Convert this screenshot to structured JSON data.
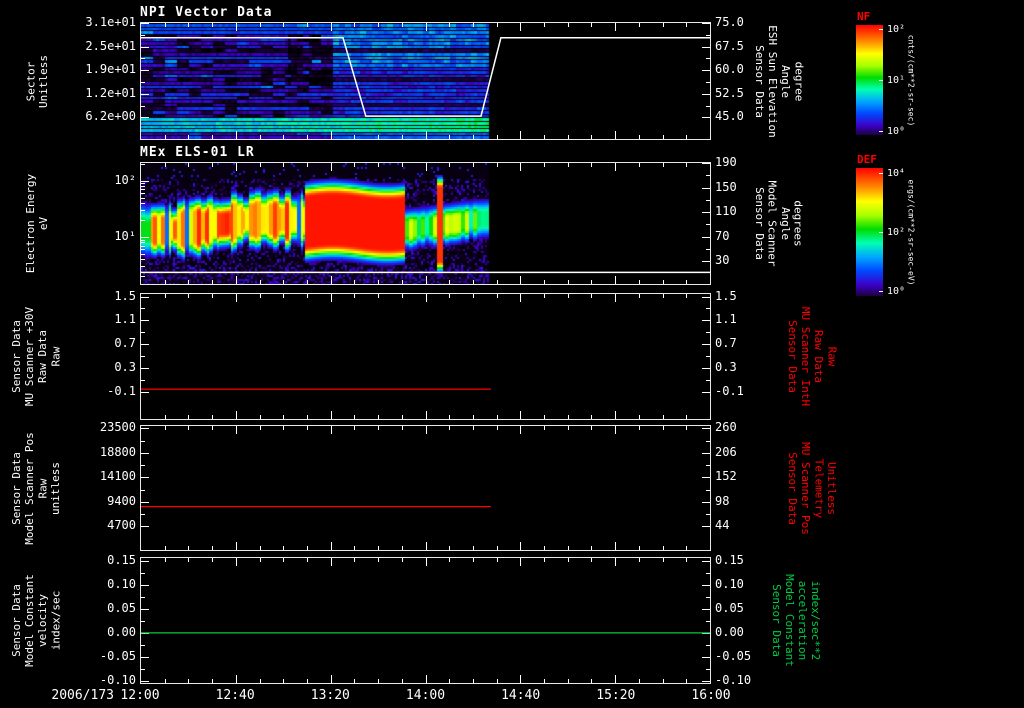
{
  "window": {
    "background": "#000000",
    "text_color": "#ffffff",
    "accent_red": "#ff0000",
    "accent_green": "#00cc44"
  },
  "time_axis": {
    "date_label": "2006/173",
    "tick_labels": [
      "12:00",
      "12:40",
      "13:20",
      "14:00",
      "14:40",
      "15:20",
      "16:00"
    ],
    "start": "12:00",
    "end": "16:00",
    "hours_span": 4
  },
  "colormap": {
    "stops": [
      0,
      0.08,
      0.16,
      0.26,
      0.36,
      0.46,
      0.56,
      0.66,
      0.76,
      0.86,
      1
    ],
    "colors": [
      "#000000",
      "#1c0040",
      "#3c00c8",
      "#0048ff",
      "#00a6ff",
      "#00ffb4",
      "#00dc00",
      "#a8ff00",
      "#ffff00",
      "#ff8c00",
      "#ff0000"
    ]
  },
  "colorbars": [
    {
      "title": "NF",
      "title_color": "#ff0000",
      "tick_labels": [
        "10²",
        "10¹",
        "10⁰"
      ],
      "tick_fracs": [
        0.04,
        0.5,
        0.96
      ],
      "unit": "cnts/(cm**2-sr-sec)"
    },
    {
      "title": "DEF",
      "title_color": "#ff0000",
      "tick_labels": [
        "10⁴",
        "10²",
        "10⁰"
      ],
      "tick_fracs": [
        0.04,
        0.5,
        0.96
      ],
      "unit": "ergs/(cm**2-sr-sec-eV)"
    }
  ],
  "chart_data": [
    {
      "type": "heatmap",
      "title": "NPI Vector Data",
      "left_label_lines": [
        "Sector",
        "Unitless"
      ],
      "left_label_color": "#ffffff",
      "left_ticks": [
        "3.1e+01",
        "2.5e+01",
        "1.9e+01",
        "1.2e+01",
        "6.2e+00"
      ],
      "left_tick_fracs": [
        0.0,
        0.203,
        0.406,
        0.61,
        0.813
      ],
      "right_ticks": [
        "75.0",
        "67.5",
        "60.0",
        "52.5",
        "45.0"
      ],
      "right_tick_fracs": [
        0.0,
        0.203,
        0.406,
        0.61,
        0.813
      ],
      "right_label_lines": [
        "Sensor Data",
        "ESH Sun Elevation",
        "Angle",
        "degree"
      ],
      "right_label_color": "#ffffff",
      "heatmap": {
        "style": "npi",
        "data_end_frac": 0.61,
        "rows": 32,
        "value_range_counts": [
          1,
          100
        ],
        "description": "Dark blue/purple sector stripes 12:00-13:20 with scattered black dropouts; brighter blue-cyan field 13:20-14:25; bright cyan-green band near the lowest sectors brightening with time; no data after ~14:25"
      },
      "overlay_line": {
        "name": "ESH sun elevation angle",
        "color": "#ffffff",
        "scale": {
          "v0": 75.0,
          "f0": 0.0,
          "v1": 45.0,
          "f1": 0.813
        },
        "points": [
          {
            "t": 0.0,
            "v": 70.3
          },
          {
            "t": 1.42,
            "v": 70.3
          },
          {
            "t": 1.58,
            "v": 45.4
          },
          {
            "t": 2.39,
            "v": 45.4
          },
          {
            "t": 2.53,
            "v": 70.3
          },
          {
            "t": 4.0,
            "v": 70.3
          }
        ]
      }
    },
    {
      "type": "heatmap",
      "title": "MEx ELS-01 LR",
      "left_label_lines": [
        "Electron Energy",
        "eV"
      ],
      "left_label_color": "#ffffff",
      "left_ticks": [
        "10²",
        "10¹"
      ],
      "left_tick_fracs": [
        0.146,
        0.611
      ],
      "log_axis": {
        "frac_per_decade": 0.465
      },
      "right_ticks": [
        "190",
        "150",
        "110",
        "70",
        "30"
      ],
      "right_tick_fracs": [
        0.0,
        0.203,
        0.406,
        0.61,
        0.813
      ],
      "right_label_lines": [
        "Sensor Data",
        "Model Scanner",
        "Angle",
        "degrees"
      ],
      "right_label_color": "#ffffff",
      "heatmap": {
        "style": "els",
        "data_end_frac": 0.61,
        "value_range_def": [
          1,
          10000
        ],
        "description": "Electron energy-time spectrogram: intense red flux band ~10-60 eV from ~12:05 to ~13:55 with vertical striations before 13:10 and a solid core 13:10-13:55; weaker green columns and a narrow red spike near 14:10; dark blue speckle background; no data after ~14:25"
      },
      "overlay_line": {
        "name": "model scanner angle",
        "color": "#ffffff",
        "scale": {
          "v0": 190,
          "f0": 0.0,
          "v1": 30,
          "f1": 0.813
        },
        "points": [
          {
            "t": 0.0,
            "v": 12
          },
          {
            "t": 4.0,
            "v": 12
          }
        ]
      }
    },
    {
      "type": "line",
      "left_label_lines": [
        "Sensor Data",
        "MU Scanner +30V",
        "Raw Data",
        "Raw"
      ],
      "left_label_color": "#ffffff",
      "left_ticks": [
        "1.5",
        "1.1",
        "0.7",
        "0.3",
        "-0.1"
      ],
      "left_tick_fracs": [
        0.02,
        0.211,
        0.402,
        0.594,
        0.785
      ],
      "right_ticks": [
        "1.5",
        "1.1",
        "0.7",
        "0.3",
        "-0.1"
      ],
      "right_tick_fracs": [
        0.02,
        0.211,
        0.402,
        0.594,
        0.785
      ],
      "right_label_lines": [
        "Sensor Data",
        "MU Scanner IntH",
        "Raw Data",
        "Raw"
      ],
      "right_label_color": "#ff0000",
      "series": [
        {
          "name": "mu-scanner-inth-raw",
          "color": "#ff0000",
          "scale": {
            "v0": 1.5,
            "f0": 0.02,
            "v1": -0.1,
            "f1": 0.785
          },
          "points": [
            {
              "t": 0.0,
              "v": -0.05
            },
            {
              "t": 2.46,
              "v": -0.05
            }
          ]
        }
      ]
    },
    {
      "type": "line",
      "left_label_lines": [
        "Sensor Data",
        "Model Scanner Pos",
        "Raw",
        "unitless"
      ],
      "left_label_color": "#ffffff",
      "left_ticks": [
        "23500",
        "18800",
        "14100",
        "9400",
        "4700"
      ],
      "left_tick_fracs": [
        0.02,
        0.2175,
        0.415,
        0.6125,
        0.81
      ],
      "right_ticks": [
        "260",
        "206",
        "152",
        "98",
        "44"
      ],
      "right_tick_fracs": [
        0.02,
        0.2175,
        0.415,
        0.6125,
        0.81
      ],
      "right_label_lines": [
        "Sensor Data",
        "MU Scanner Pos",
        "Telemetry",
        "Unitless"
      ],
      "right_label_color": "#ff0000",
      "series": [
        {
          "name": "model-scanner-pos-raw",
          "color": "#ff0000",
          "scale": {
            "v0": 23500,
            "f0": 0.02,
            "v1": 4700,
            "f1": 0.81
          },
          "points": [
            {
              "t": 0.0,
              "v": 8500
            },
            {
              "t": 2.46,
              "v": 8500
            }
          ]
        }
      ]
    },
    {
      "type": "line",
      "left_label_lines": [
        "Sensor Data",
        "Model Constant",
        "velocity",
        "index/sec"
      ],
      "left_label_color": "#ffffff",
      "left_ticks": [
        "0.15",
        "0.10",
        "0.05",
        "0.00",
        "-0.05",
        "-0.10"
      ],
      "left_tick_fracs": [
        0.02,
        0.213,
        0.406,
        0.599,
        0.792,
        0.985
      ],
      "right_ticks": [
        "0.15",
        "0.10",
        "0.05",
        "0.00",
        "-0.05",
        "-0.10"
      ],
      "right_tick_fracs": [
        0.02,
        0.213,
        0.406,
        0.599,
        0.792,
        0.985
      ],
      "right_label_lines": [
        "Sensor Data",
        "Model Constant",
        "acceleration",
        "index/sec**2"
      ],
      "right_label_color": "#00cc44",
      "series": [
        {
          "name": "model-constant-velocity",
          "color": "#00cc44",
          "scale": {
            "v0": 0.15,
            "f0": 0.02,
            "v1": -0.1,
            "f1": 0.985
          },
          "points": [
            {
              "t": 0.0,
              "v": 0.0
            },
            {
              "t": 4.0,
              "v": 0.0
            }
          ]
        }
      ]
    }
  ]
}
